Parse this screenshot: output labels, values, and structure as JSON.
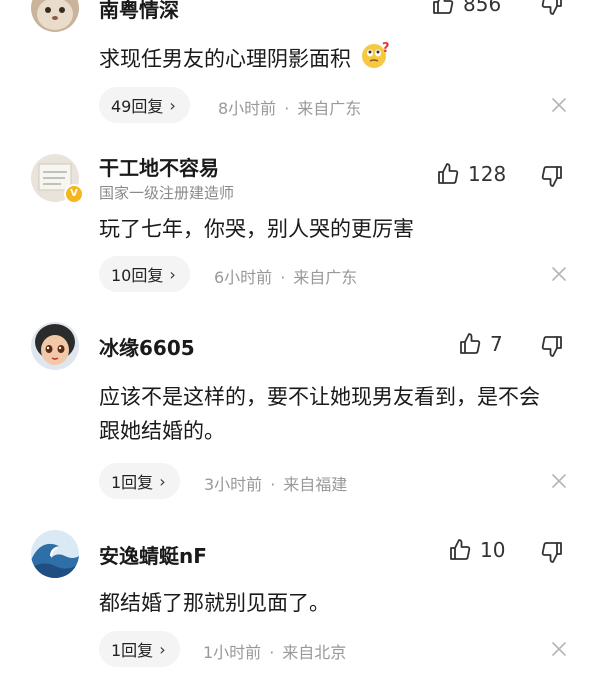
{
  "comments": [
    {
      "username": "南粤情深",
      "user_title": "",
      "likes": "856",
      "content": "求现任男友的心理阴影面积",
      "emoji": "thinking-face-icon",
      "reply_label": "49回复",
      "time": "8小时前",
      "location": "来自广东"
    },
    {
      "username": "干工地不容易",
      "user_title": "国家一级注册建造师",
      "likes": "128",
      "content": "玩了七年，你哭，别人哭的更厉害",
      "reply_label": "10回复",
      "time": "6小时前",
      "location": "来自广东"
    },
    {
      "username": "冰缘6605",
      "user_title": "",
      "likes": "7",
      "content": "应该不是这样的，要不让她现男友看到，是不会跟她结婚的。",
      "reply_label": "1回复",
      "time": "3小时前",
      "location": "来自福建"
    },
    {
      "username": "安逸蜻蜓nF",
      "user_title": "",
      "likes": "10",
      "content": "都结婚了那就别见面了。",
      "reply_label": "1回复",
      "time": "1小时前",
      "location": "来自北京"
    }
  ],
  "meta_separator": "·",
  "chevron": "›",
  "verified_badge": "V",
  "colors": {
    "text_primary": "#1a1a1a",
    "text_secondary": "#999999",
    "pill_bg": "#f4f4f4",
    "badge": "#f5b51c"
  }
}
